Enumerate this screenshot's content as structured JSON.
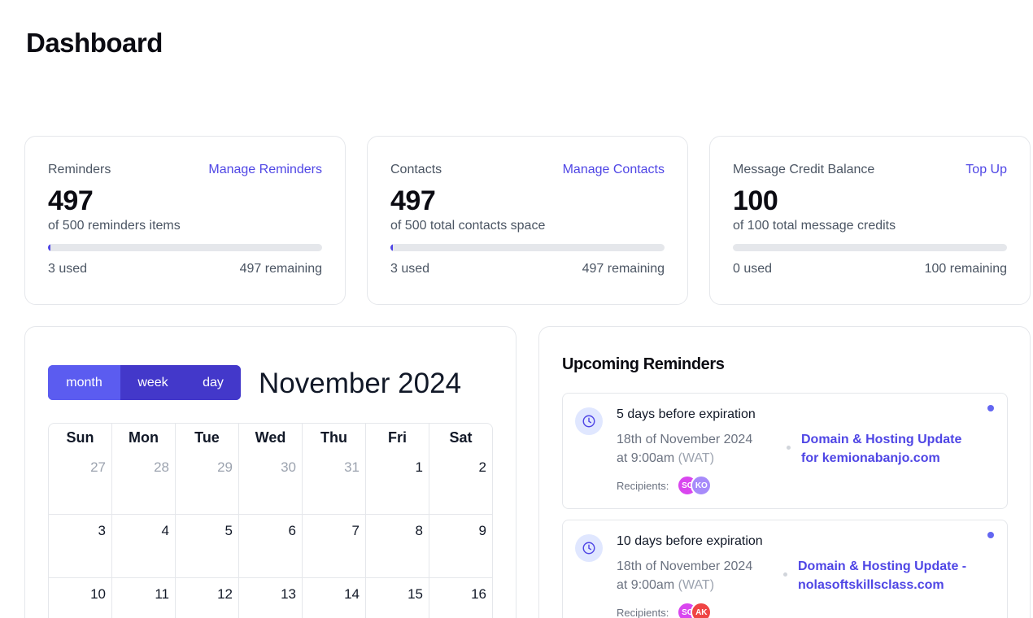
{
  "page": {
    "title": "Dashboard"
  },
  "stats": [
    {
      "label": "Reminders",
      "link": "Manage Reminders",
      "value": "497",
      "sub": "of 500 reminders items",
      "used": "3 used",
      "remaining": "497 remaining",
      "progress_fraction": 0.006
    },
    {
      "label": "Contacts",
      "link": "Manage Contacts",
      "value": "497",
      "sub": "of 500 total contacts space",
      "used": "3 used",
      "remaining": "497 remaining",
      "progress_fraction": 0.006
    },
    {
      "label": "Message Credit Balance",
      "link": "Top Up",
      "value": "100",
      "sub": "of 100 total message credits",
      "used": "0 used",
      "remaining": "100 remaining",
      "progress_fraction": 0
    }
  ],
  "calendar": {
    "views": [
      "month",
      "week",
      "day"
    ],
    "active_view": "month",
    "title": "November 2024",
    "weekdays": [
      "Sun",
      "Mon",
      "Tue",
      "Wed",
      "Thu",
      "Fri",
      "Sat"
    ],
    "weeks": [
      [
        {
          "d": "27",
          "muted": true
        },
        {
          "d": "28",
          "muted": true
        },
        {
          "d": "29",
          "muted": true
        },
        {
          "d": "30",
          "muted": true
        },
        {
          "d": "31",
          "muted": true
        },
        {
          "d": "1"
        },
        {
          "d": "2"
        }
      ],
      [
        {
          "d": "3"
        },
        {
          "d": "4"
        },
        {
          "d": "5"
        },
        {
          "d": "6"
        },
        {
          "d": "7"
        },
        {
          "d": "8"
        },
        {
          "d": "9"
        }
      ],
      [
        {
          "d": "10"
        },
        {
          "d": "11"
        },
        {
          "d": "12"
        },
        {
          "d": "13"
        },
        {
          "d": "14"
        },
        {
          "d": "15"
        },
        {
          "d": "16"
        }
      ]
    ]
  },
  "upcoming": {
    "title": "Upcoming Reminders",
    "recipients_label": "Recipients:",
    "items": [
      {
        "title": "5 days before expiration",
        "date_line1": "18th of November 2024",
        "date_line2": "at 9:00am",
        "tz": "(WAT)",
        "link_line1": "Domain & Hosting Update",
        "link_line2": "for kemionabanjo.com",
        "recipients": [
          {
            "initials": "SO",
            "color": "#d946ef"
          },
          {
            "initials": "KO",
            "color": "#a78bfa"
          }
        ]
      },
      {
        "title": "10 days before expiration",
        "date_line1": "18th of November 2024",
        "date_line2": "at 9:00am",
        "tz": "(WAT)",
        "link_line1": "Domain & Hosting Update -",
        "link_line2": "nolasoftskillsclass.com",
        "recipients": [
          {
            "initials": "SO",
            "color": "#d946ef"
          },
          {
            "initials": "AK",
            "color": "#ef4444"
          }
        ]
      }
    ]
  },
  "colors": {
    "accent": "#4f46e5",
    "toggle": "#5b5cf0",
    "toggle_active": "#4338ca"
  }
}
